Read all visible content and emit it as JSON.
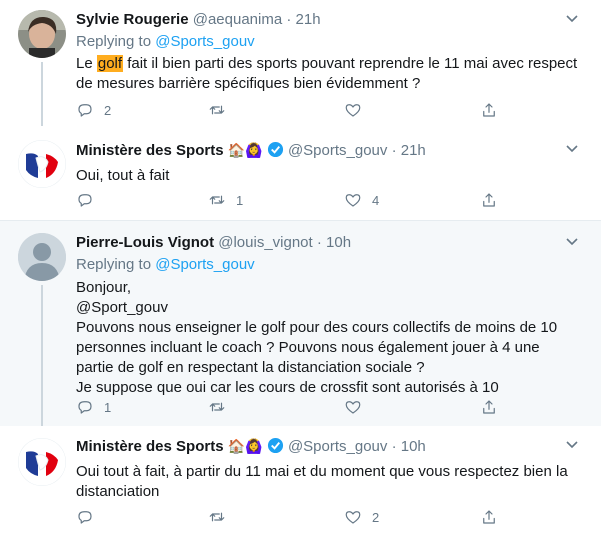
{
  "tweets": [
    {
      "name": "Sylvie Rougerie",
      "handle": "@aequanima",
      "time": "21h",
      "replying_label": "Replying to",
      "replying_to": "@Sports_gouv",
      "text_before": "Le ",
      "text_highlight": "golf",
      "text_after": " fait il bien parti des sports pouvant reprendre le 11 mai avec respect de mesures barrière spécifiques  bien évidemment ?",
      "replies": "2",
      "retweets": "",
      "likes": ""
    },
    {
      "name": "Ministère des Sports",
      "emojis": "🏠🙆‍♀️",
      "handle": "@Sports_gouv",
      "time": "21h",
      "text": "Oui, tout à fait",
      "replies": "",
      "retweets": "1",
      "likes": "4"
    },
    {
      "name": "Pierre-Louis Vignot",
      "handle": "@louis_vignot",
      "time": "10h",
      "replying_label": "Replying to",
      "replying_to": "@Sports_gouv",
      "text_lines": [
        "Bonjour,",
        "@Sport_gouv",
        "Pouvons nous enseigner le golf pour des cours collectifs de moins de 10 personnes incluant le coach ? Pouvons nous également jouer à 4 une partie de golf en respectant la distanciation sociale ?",
        "Je suppose que oui car les cours de crossfit sont autorisés à 10"
      ],
      "replies": "1",
      "retweets": "",
      "likes": ""
    },
    {
      "name": "Ministère des Sports",
      "emojis": "🏠🙆‍♀️",
      "handle": "@Sports_gouv",
      "time": "10h",
      "text": "Oui tout à fait, à partir du 11 mai et du moment que vous respectez bien la distanciation",
      "replies": "",
      "retweets": "",
      "likes": "2"
    }
  ],
  "separator_dot": "·",
  "colors": {
    "accent": "#1da1f2",
    "muted": "#657786",
    "highlight": "#ffad1f",
    "verified": "#1da1f2"
  }
}
